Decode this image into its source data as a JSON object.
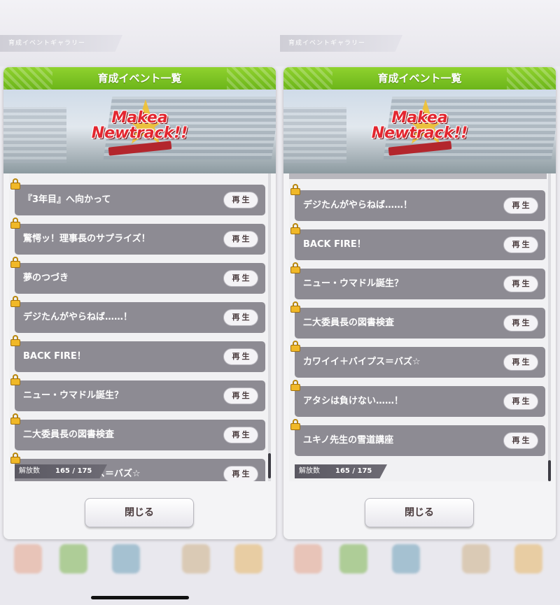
{
  "breadcrumb": "育成イベントギャラリー",
  "panels": [
    {
      "header_title": "育成イベント一覧",
      "banner": {
        "logo_line1": "Makea",
        "logo_line2": "Newtrack!!"
      },
      "rows": [
        {
          "label": "『3年目』へ向かって",
          "button": "再生"
        },
        {
          "label": "驚愕ッ！理事長のサプライズ！",
          "button": "再生"
        },
        {
          "label": "夢のつづき",
          "button": "再生"
        },
        {
          "label": "デジたんがやらねば……！",
          "button": "再生"
        },
        {
          "label": "BACK FIRE！",
          "button": "再生"
        },
        {
          "label": "ニュー・ウマドル誕生？",
          "button": "再生"
        },
        {
          "label": "二大委員長の図書検査",
          "button": "再生"
        },
        {
          "label": "カワイイ＋バイプス＝バズ☆",
          "button": "再生"
        }
      ],
      "unlock_label": "解放数",
      "unlock_count": "165 / 175",
      "close_label": "閉じる"
    },
    {
      "header_title": "育成イベント一覧",
      "banner": {
        "logo_line1": "Makea",
        "logo_line2": "Newtrack!!"
      },
      "rows": [
        {
          "label": "デジたんがやらねば……！",
          "button": "再生"
        },
        {
          "label": "BACK FIRE！",
          "button": "再生"
        },
        {
          "label": "ニュー・ウマドル誕生？",
          "button": "再生"
        },
        {
          "label": "二大委員長の図書検査",
          "button": "再生"
        },
        {
          "label": "カワイイ＋バイプス＝バズ☆",
          "button": "再生"
        },
        {
          "label": "アタシは負けない……！",
          "button": "再生"
        },
        {
          "label": "ユキノ先生の雪道講座",
          "button": "再生"
        }
      ],
      "unlock_label": "解放数",
      "unlock_count": "165 / 175",
      "close_label": "閉じる"
    }
  ],
  "colors": {
    "header_green": "#7cc424",
    "row_gray": "#8d8b93",
    "lock_gold": "#f0b828"
  }
}
